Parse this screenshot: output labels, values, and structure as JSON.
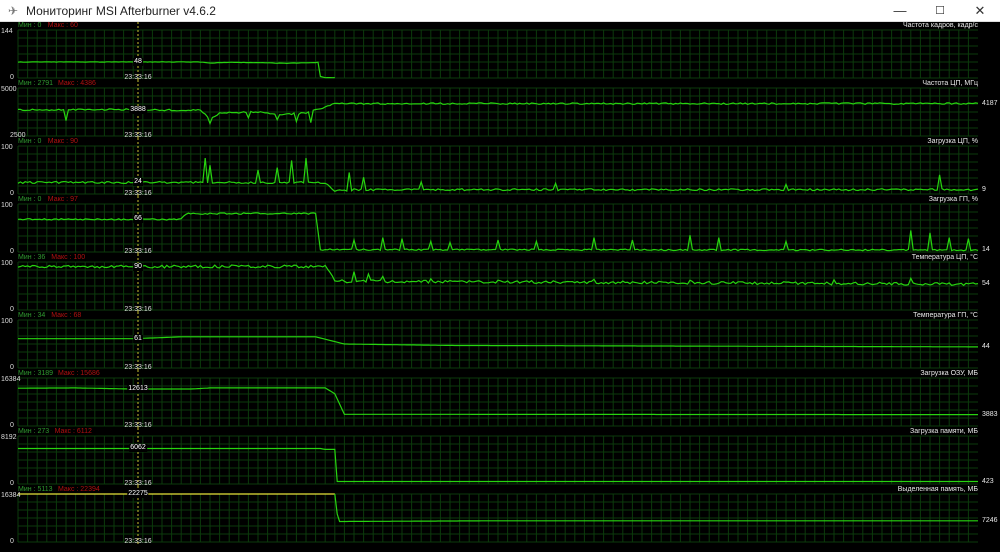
{
  "window": {
    "title": "Мониторинг MSI Afterburner v4.6.2",
    "minimize": "—",
    "maximize": "☐",
    "close": "✕"
  },
  "cursor_time": "23:33:16",
  "colors": {
    "line": "#27d40f",
    "yellow": "#e6e33a",
    "grid": "#0c3a0c",
    "cursor": "#c8c030"
  },
  "graphs": [
    {
      "title": "Частота кадров, кадр/с",
      "min_label": "Мин : 0",
      "max_label": "Макс : 60",
      "scale_top": "144",
      "scale_bottom": "0",
      "ymin": 0,
      "ymax": 144,
      "cursor_value": "48",
      "right_value": "",
      "noise": 0.6,
      "points": [
        [
          0,
          48
        ],
        [
          12,
          48.5
        ],
        [
          19,
          48
        ],
        [
          20,
          45
        ],
        [
          22,
          47
        ],
        [
          25,
          46
        ],
        [
          28,
          44
        ],
        [
          31.3,
          47
        ],
        [
          31.5,
          5
        ],
        [
          32,
          1
        ],
        [
          33,
          1
        ]
      ]
    },
    {
      "title": "Частота ЦП, МГц",
      "min_label": "Мин : 2791",
      "max_label": "Макс : 4386",
      "scale_top": "5000",
      "scale_bottom": "2500",
      "ymin": 2500,
      "ymax": 5000,
      "cursor_value": "3888",
      "right_value": "4187",
      "noise": 40,
      "points": [
        [
          0,
          3850
        ],
        [
          10,
          3880
        ],
        [
          19,
          3840
        ],
        [
          20,
          3400
        ],
        [
          21,
          3700
        ],
        [
          25,
          3750
        ],
        [
          27,
          3600
        ],
        [
          30,
          3700
        ],
        [
          31,
          3850
        ],
        [
          33,
          4187
        ],
        [
          100,
          4187
        ]
      ],
      "spikes": [
        [
          5,
          3300
        ],
        [
          20,
          3150
        ],
        [
          24,
          3450
        ],
        [
          27,
          3350
        ],
        [
          29,
          3250
        ],
        [
          30.5,
          3200
        ]
      ]
    },
    {
      "title": "Загрузка ЦП, %",
      "min_label": "Мин : 0",
      "max_label": "Макс : 90",
      "scale_top": "100",
      "scale_bottom": "0",
      "ymin": 0,
      "ymax": 100,
      "cursor_value": "24",
      "right_value": "9",
      "noise": 2,
      "points": [
        [
          0,
          24
        ],
        [
          32,
          24
        ],
        [
          33,
          6
        ],
        [
          35,
          9
        ],
        [
          100,
          9
        ]
      ],
      "spikes": [
        [
          19.5,
          75
        ],
        [
          20,
          60
        ],
        [
          25,
          50
        ],
        [
          27,
          55
        ],
        [
          28.5,
          70
        ],
        [
          30,
          75
        ],
        [
          34.5,
          45
        ],
        [
          36,
          35
        ],
        [
          42,
          25
        ],
        [
          56,
          22
        ],
        [
          96,
          40
        ],
        [
          80,
          20
        ]
      ]
    },
    {
      "title": "Загрузка ГП, %",
      "min_label": "Мин : 0",
      "max_label": "Макс : 97",
      "scale_top": "100",
      "scale_bottom": "0",
      "ymin": 0,
      "ymax": 100,
      "cursor_value": "66",
      "right_value": "14",
      "noise": 1.5,
      "points": [
        [
          0,
          68
        ],
        [
          17,
          68
        ],
        [
          17.5,
          80
        ],
        [
          31,
          80
        ],
        [
          31.5,
          5
        ],
        [
          100,
          4
        ]
      ],
      "spikes": [
        [
          35,
          25
        ],
        [
          38,
          30
        ],
        [
          40,
          28
        ],
        [
          43,
          22
        ],
        [
          45,
          20
        ],
        [
          50,
          25
        ],
        [
          54,
          22
        ],
        [
          60,
          30
        ],
        [
          64,
          25
        ],
        [
          70,
          35
        ],
        [
          73,
          30
        ],
        [
          80,
          22
        ],
        [
          93,
          45
        ],
        [
          95,
          40
        ],
        [
          97,
          30
        ],
        [
          99,
          28
        ]
      ]
    },
    {
      "title": "Температура ЦП, °С",
      "min_label": "Мин : 36",
      "max_label": "Макс : 100",
      "scale_top": "100",
      "scale_bottom": "0",
      "ymin": 0,
      "ymax": 100,
      "cursor_value": "90",
      "right_value": "54",
      "noise": 3,
      "points": [
        [
          0,
          90
        ],
        [
          32,
          91
        ],
        [
          33,
          60
        ],
        [
          100,
          54
        ]
      ],
      "spikes": [
        [
          35,
          80
        ],
        [
          36.5,
          75
        ],
        [
          38,
          70
        ],
        [
          43,
          65
        ],
        [
          50,
          62
        ],
        [
          60,
          64
        ],
        [
          70,
          62
        ],
        [
          85,
          63
        ],
        [
          93,
          66
        ]
      ]
    },
    {
      "title": "Температура ГП, °С",
      "min_label": "Мин : 34",
      "max_label": "Макс : 68",
      "scale_top": "100",
      "scale_bottom": "0",
      "ymin": 0,
      "ymax": 100,
      "cursor_value": "61",
      "right_value": "44",
      "noise": 0,
      "points": [
        [
          0,
          61
        ],
        [
          12,
          61
        ],
        [
          17,
          65
        ],
        [
          31,
          65
        ],
        [
          34,
          50
        ],
        [
          45,
          47
        ],
        [
          100,
          44
        ]
      ]
    },
    {
      "title": "Загрузка ОЗУ, МБ",
      "min_label": "Мин : 3189",
      "max_label": "Макс : 15686",
      "scale_top": "16384",
      "scale_bottom": "0",
      "ymin": 0,
      "ymax": 16384,
      "cursor_value": "12613",
      "right_value": "3883",
      "noise": 0,
      "points": [
        [
          0,
          12900
        ],
        [
          6,
          13000
        ],
        [
          12,
          12613
        ],
        [
          18,
          12613
        ],
        [
          20,
          13000
        ],
        [
          32,
          13000
        ],
        [
          33,
          11000
        ],
        [
          34,
          4000
        ],
        [
          100,
          3883
        ]
      ]
    },
    {
      "title": "Загрузка памяти, МБ",
      "min_label": "Мин : 273",
      "max_label": "Макс : 6112",
      "scale_top": "8192",
      "scale_bottom": "0",
      "ymin": 0,
      "ymax": 8192,
      "cursor_value": "6062",
      "right_value": "423",
      "noise": 0,
      "points": [
        [
          0,
          6062
        ],
        [
          31.5,
          6062
        ],
        [
          32,
          5900
        ],
        [
          33,
          5900
        ],
        [
          33.2,
          423
        ],
        [
          100,
          423
        ]
      ]
    },
    {
      "title": "Выделенная память, МБ",
      "min_label": "Мин : 5113",
      "max_label": "Макс : 22394",
      "scale_top": "16384",
      "scale_bottom": "0",
      "ymin": 0,
      "ymax": 16384,
      "cursor_value": "22275",
      "right_value": "7246",
      "noise": 0,
      "yellow_until": 33,
      "points": [
        [
          0,
          22275
        ],
        [
          33,
          22275
        ],
        [
          33.3,
          7000
        ],
        [
          50,
          7246
        ],
        [
          100,
          7246
        ]
      ]
    }
  ],
  "chart_data": {
    "type": "line",
    "x_range": [
      0,
      100
    ],
    "cursor_x": 12.5,
    "note": "time axis in sample index units"
  }
}
